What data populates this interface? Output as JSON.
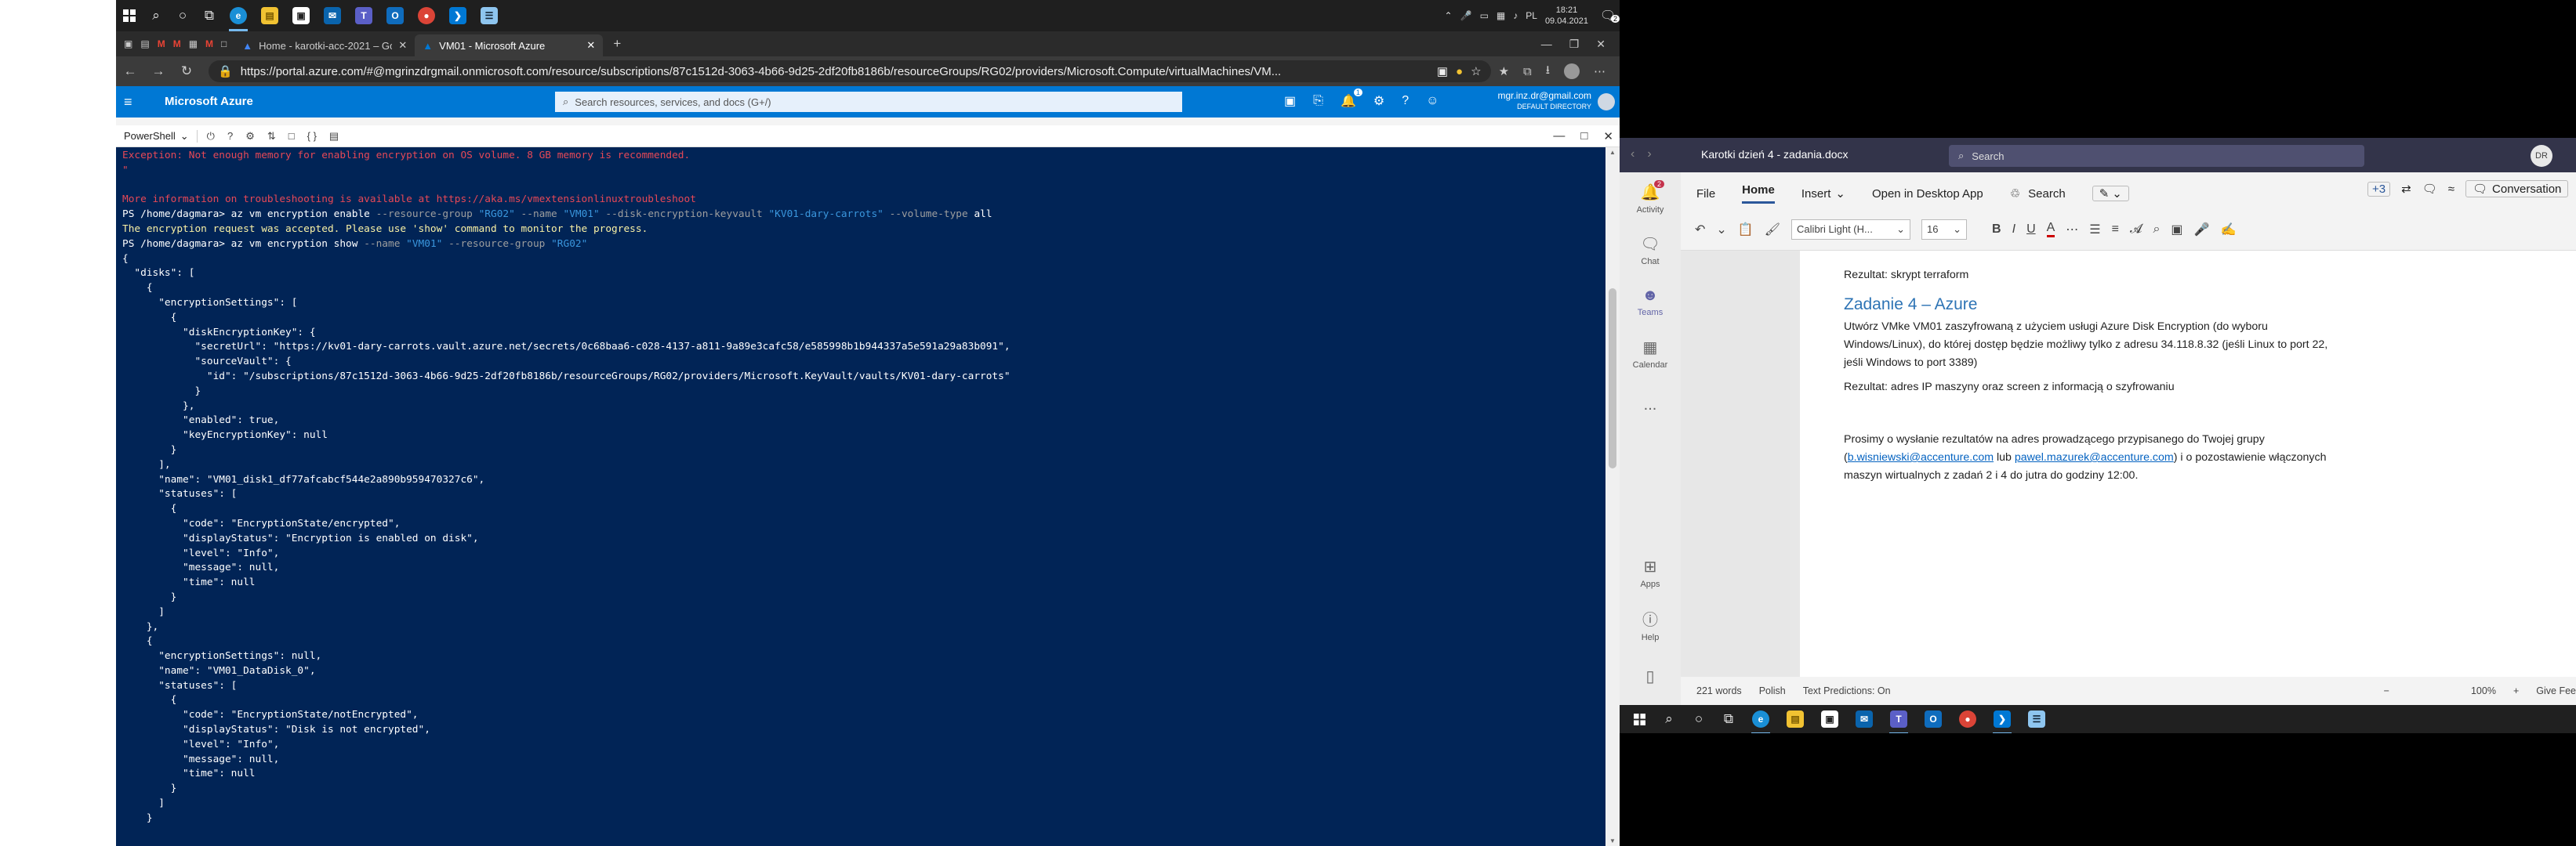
{
  "top_taskbar": {
    "clock_time": "18:21",
    "clock_date": "09.04.2021",
    "notification_count": "2"
  },
  "browser": {
    "tabs": [
      {
        "label": "Home - karotki-acc-2021 – Goo"
      },
      {
        "label": "VM01 - Microsoft Azure"
      }
    ],
    "url": "https://portal.azure.com/#@mgrinzdrgmail.onmicrosoft.com/resource/subscriptions/87c1512d-3063-4b66-9d25-2df20fb8186b/resourceGroups/RG02/providers/Microsoft.Compute/virtualMachines/VM..."
  },
  "azure": {
    "brand": "Microsoft Azure",
    "search_placeholder": "Search resources, services, and docs (G+/)",
    "account_email": "mgr.inz.dr@gmail.com",
    "directory": "DEFAULT DIRECTORY",
    "notification_badge": "1"
  },
  "cloud_shell": {
    "shell_selector": "PowerShell"
  },
  "console_lines": [
    {
      "t": "Exception: Not enough memory for enabling encryption on OS volume. 8 GB memory is recommended.",
      "c": "err"
    },
    {
      "t": "\"",
      "c": "err"
    },
    {
      "t": "",
      "c": ""
    },
    {
      "t": "More information on troubleshooting is available at https://aka.ms/vmextensionlinuxtroubleshoot",
      "c": "err"
    },
    {
      "t": "PS /home/dagmara> az vm encryption enable --resource-group \"RG02\" --name \"VM01\" --disk-encryption-keyvault \"KV01-dary-carrots\" --volume-type all",
      "c": "cmd1"
    },
    {
      "t": "The encryption request was accepted. Please use 'show' command to monitor the progress.",
      "c": "warn"
    },
    {
      "t": "PS /home/dagmara> az vm encryption show --name \"VM01\" --resource-group \"RG02\"",
      "c": "cmd2"
    },
    {
      "t": "{",
      "c": ""
    },
    {
      "t": "  \"disks\": [",
      "c": ""
    },
    {
      "t": "    {",
      "c": ""
    },
    {
      "t": "      \"encryptionSettings\": [",
      "c": ""
    },
    {
      "t": "        {",
      "c": ""
    },
    {
      "t": "          \"diskEncryptionKey\": {",
      "c": ""
    },
    {
      "t": "            \"secretUrl\": \"https://kv01-dary-carrots.vault.azure.net/secrets/0c68baa6-c028-4137-a811-9a89e3cafc58/e585998b1b944337a5e591a29a83b091\",",
      "c": ""
    },
    {
      "t": "            \"sourceVault\": {",
      "c": ""
    },
    {
      "t": "              \"id\": \"/subscriptions/87c1512d-3063-4b66-9d25-2df20fb8186b/resourceGroups/RG02/providers/Microsoft.KeyVault/vaults/KV01-dary-carrots\"",
      "c": ""
    },
    {
      "t": "            }",
      "c": ""
    },
    {
      "t": "          },",
      "c": ""
    },
    {
      "t": "          \"enabled\": true,",
      "c": ""
    },
    {
      "t": "          \"keyEncryptionKey\": null",
      "c": ""
    },
    {
      "t": "        }",
      "c": ""
    },
    {
      "t": "      ],",
      "c": ""
    },
    {
      "t": "      \"name\": \"VM01_disk1_df77afcabcf544e2a890b959470327c6\",",
      "c": ""
    },
    {
      "t": "      \"statuses\": [",
      "c": ""
    },
    {
      "t": "        {",
      "c": ""
    },
    {
      "t": "          \"code\": \"EncryptionState/encrypted\",",
      "c": ""
    },
    {
      "t": "          \"displayStatus\": \"Encryption is enabled on disk\",",
      "c": ""
    },
    {
      "t": "          \"level\": \"Info\",",
      "c": ""
    },
    {
      "t": "          \"message\": null,",
      "c": ""
    },
    {
      "t": "          \"time\": null",
      "c": ""
    },
    {
      "t": "        }",
      "c": ""
    },
    {
      "t": "      ]",
      "c": ""
    },
    {
      "t": "    },",
      "c": ""
    },
    {
      "t": "    {",
      "c": ""
    },
    {
      "t": "      \"encryptionSettings\": null,",
      "c": ""
    },
    {
      "t": "      \"name\": \"VM01_DataDisk_0\",",
      "c": ""
    },
    {
      "t": "      \"statuses\": [",
      "c": ""
    },
    {
      "t": "        {",
      "c": ""
    },
    {
      "t": "          \"code\": \"EncryptionState/notEncrypted\",",
      "c": ""
    },
    {
      "t": "          \"displayStatus\": \"Disk is not encrypted\",",
      "c": ""
    },
    {
      "t": "          \"level\": \"Info\",",
      "c": ""
    },
    {
      "t": "          \"message\": null,",
      "c": ""
    },
    {
      "t": "          \"time\": null",
      "c": ""
    },
    {
      "t": "        }",
      "c": ""
    },
    {
      "t": "      ]",
      "c": ""
    },
    {
      "t": "    }",
      "c": ""
    }
  ],
  "teams": {
    "title": "Karotki dzień 4 - zadania.docx",
    "search_placeholder": "Search",
    "avatar_initials": "DR",
    "rail": [
      {
        "label": "Activity",
        "badge": "2"
      },
      {
        "label": "Chat"
      },
      {
        "label": "Teams"
      },
      {
        "label": "Calendar"
      },
      {
        "label": "..."
      },
      {
        "label": "Apps"
      },
      {
        "label": "Help"
      }
    ]
  },
  "word": {
    "menu": [
      "File",
      "Home",
      "Insert",
      "Open in Desktop App",
      "Search"
    ],
    "conversation": "Conversation",
    "plus_count": "+3",
    "font_name": "Calibri Light (H...",
    "font_size": "16",
    "result1": "Rezultat: skrypt terraform",
    "heading": "Zadanie 4 – Azure",
    "task_line1": "Utwórz VMke VM01 zaszyfrowaną z użyciem usługi Azure Disk Encryption (do wyboru",
    "task_line2": "Windows/Linux), do której dostęp będzie możliwy tylko z adresu 34.118.8.32 (jeśli Linux to port 22,",
    "task_line3": "jeśli Windows to port 3389)",
    "result2": "Rezultat: adres IP maszyny oraz screen z informacją o szyfrowaniu",
    "closing_line1": "Prosimy o wysłanie rezultatów na adres prowadzącego przypisanego do Twojej grupy",
    "email1": "b.wisniewski@accenture.com",
    "or": " lub ",
    "email2": "pawel.mazurek@accenture.com",
    "closing_line1_end": ") i o pozostawienie włączonych",
    "closing_line2": "maszyn wirtualnych z zadań 2 i 4 do jutra do godziny 12:00.",
    "status_words": "221 words",
    "status_lang": "Polish",
    "status_predictions": "Text Predictions: On",
    "zoom": "100%",
    "feedback": "Give Fee"
  }
}
